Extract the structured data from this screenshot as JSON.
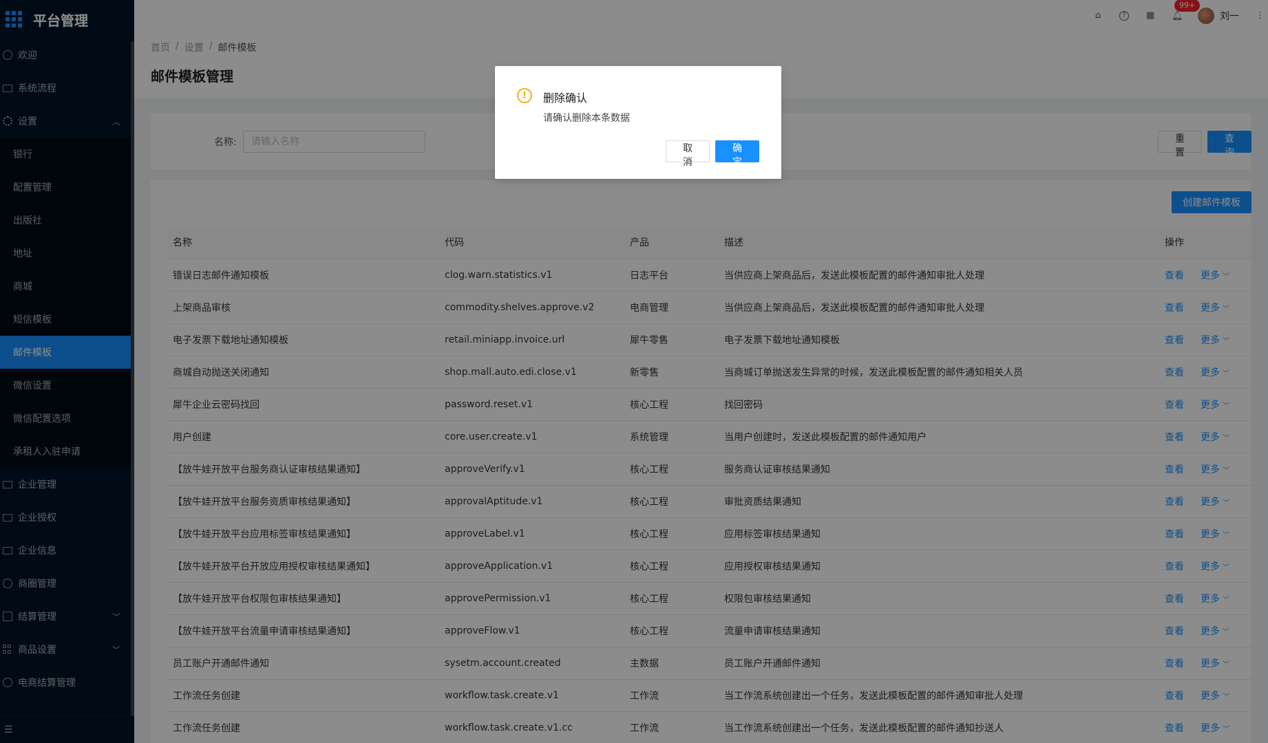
{
  "app": {
    "title": "平台管理"
  },
  "sidebar": {
    "items": [
      {
        "label": "欢迎",
        "icon": "smile-icon"
      },
      {
        "label": "系统流程",
        "icon": "mail-icon"
      },
      {
        "label": "设置",
        "icon": "gear-icon",
        "expanded": true
      }
    ],
    "sub_items": [
      "银行",
      "配置管理",
      "出版社",
      "地址",
      "商城",
      "短信模板",
      "邮件模板",
      "微信设置",
      "微信配置选项",
      "承租人入驻申请"
    ],
    "active_sub": "邮件模板",
    "items_after": [
      {
        "label": "企业管理",
        "icon": "mail-icon"
      },
      {
        "label": "企业授权",
        "icon": "mail-icon"
      },
      {
        "label": "企业信息",
        "icon": "mail-icon"
      },
      {
        "label": "商圈管理",
        "icon": "compass-icon"
      },
      {
        "label": "结算管理",
        "icon": "calendar-icon",
        "has_children": true
      },
      {
        "label": "商品设置",
        "icon": "appstore-icon",
        "has_children": true
      },
      {
        "label": "电商结算管理",
        "icon": "setting-icon"
      }
    ]
  },
  "header": {
    "notification_badge": "99+",
    "user_name": "刘一"
  },
  "breadcrumb": [
    "首页",
    "设置",
    "邮件模板"
  ],
  "page_title": "邮件模板管理",
  "search": {
    "name_label": "名称:",
    "name_placeholder": "请输入名称",
    "reset_label": "重 置",
    "query_label": "查 询"
  },
  "table": {
    "create_label": "创建邮件模板",
    "columns": [
      "名称",
      "代码",
      "产品",
      "描述",
      "操作"
    ],
    "view_label": "查看",
    "more_label": "更多",
    "rows": [
      [
        "错误日志邮件通知模板",
        "clog.warn.statistics.v1",
        "日志平台",
        "当供应商上架商品后，发送此模板配置的邮件通知审批人处理"
      ],
      [
        "上架商品审核",
        "commodity.shelves.approve.v2",
        "电商管理",
        "当供应商上架商品后，发送此模板配置的邮件通知审批人处理"
      ],
      [
        "电子发票下载地址通知模板",
        "retail.miniapp.invoice.url",
        "犀牛零售",
        "电子发票下载地址通知模板"
      ],
      [
        "商城自动抛送关闭通知",
        "shop.mall.auto.edi.close.v1",
        "新零售",
        "当商城订单抛送发生异常的时候，发送此模板配置的邮件通知相关人员"
      ],
      [
        "犀牛企业云密码找回",
        "password.reset.v1",
        "核心工程",
        "找回密码"
      ],
      [
        "用户创建",
        "core.user.create.v1",
        "系统管理",
        "当用户创建时，发送此模板配置的邮件通知用户"
      ],
      [
        "【放牛娃开放平台服务商认证审核结果通知】",
        "approveVerify.v1",
        "核心工程",
        "服务商认证审核结果通知"
      ],
      [
        "【放牛娃开放平台服务资质审核结果通知】",
        "approvalAptitude.v1",
        "核心工程",
        "审批资质结果通知"
      ],
      [
        "【放牛娃开放平台应用标签审核结果通知】",
        "approveLabel.v1",
        "核心工程",
        "应用标签审核结果通知"
      ],
      [
        "【放牛娃开放平台开放应用授权审核结果通知】",
        "approveApplication.v1",
        "核心工程",
        "应用授权审核结果通知"
      ],
      [
        "【放牛娃开放平台权限包审核结果通知】",
        "approvePermission.v1",
        "核心工程",
        "权限包审核结果通知"
      ],
      [
        "【放牛娃开放平台流量申请审核结果通知】",
        "approveFlow.v1",
        "核心工程",
        "流量申请审核结果通知"
      ],
      [
        "员工账户开通邮件通知",
        "sysetm.account.created",
        "主数据",
        "员工账户开通邮件通知"
      ],
      [
        "工作流任务创建",
        "workflow.task.create.v1",
        "工作流",
        "当工作流系统创建出一个任务，发送此模板配置的邮件通知审批人处理"
      ],
      [
        "工作流任务创建",
        "workflow.task.create.v1.cc",
        "工作流",
        "当工作流系统创建出一个任务，发送此模板配置的邮件通知抄送人"
      ]
    ]
  },
  "modal": {
    "title": "删除确认",
    "content": "请确认删除本条数据",
    "cancel_label": "取 消",
    "ok_label": "确 定"
  },
  "colors": {
    "primary": "#1890ff",
    "sidebar_bg": "#001529",
    "warning": "#faad14",
    "badge": "#f5222d"
  }
}
